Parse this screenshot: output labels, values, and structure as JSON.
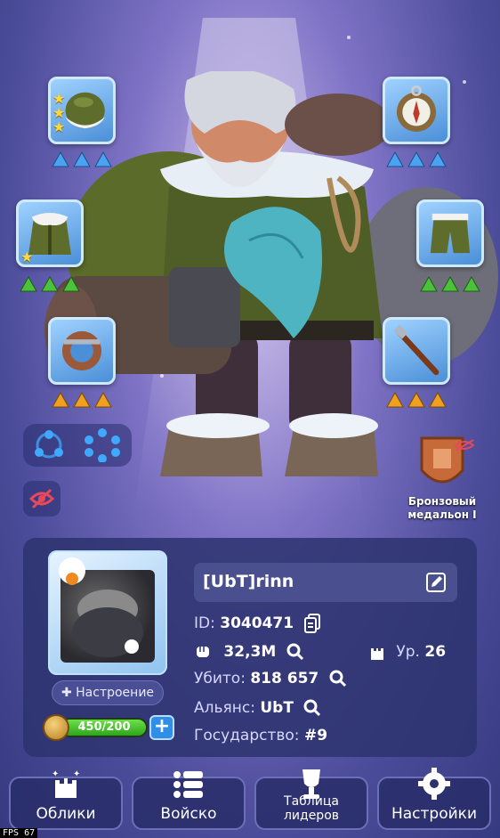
{
  "equipment": {
    "helmet": {
      "stars": 3,
      "gems": [
        "blue",
        "blue",
        "blue"
      ]
    },
    "armor": {
      "stars": 1,
      "gems": [
        "green",
        "green",
        "green"
      ]
    },
    "ring": {
      "stars": 0,
      "gems": [
        "orange",
        "orange",
        "orange"
      ]
    },
    "compass": {
      "stars": 0,
      "gems": [
        "blue",
        "blue",
        "blue"
      ]
    },
    "pants": {
      "stars": 0,
      "gems": [
        "green",
        "green",
        "green"
      ]
    },
    "staff": {
      "stars": 0,
      "gems": [
        "orange",
        "orange",
        "orange"
      ]
    }
  },
  "medal": {
    "line1": "Бронзовый",
    "line2": "медальон I"
  },
  "profile": {
    "name": "[UbT]rinn",
    "id_label": "ID:",
    "id_value": "3040471",
    "power": "32,3M",
    "level_label": "Ур.",
    "level_value": "26",
    "kills_label": "Убито:",
    "kills_value": "818 657",
    "alliance_label": "Альянс:",
    "alliance_value": "UbT",
    "state_label": "Государство:",
    "state_value": "#9",
    "mood_label": "Настроение",
    "energy_text": "450/200",
    "energy_fraction": 1.0
  },
  "nav": {
    "skins": "Облики",
    "army": "Войско",
    "leaderboard": "Таблица лидеров",
    "settings": "Настройки"
  },
  "fps": "FPS 67",
  "colors": {
    "gem_blue": "#4aa3f0",
    "gem_green": "#4cc23a",
    "gem_orange": "#f0a020",
    "accent": "#2f8fe8"
  }
}
